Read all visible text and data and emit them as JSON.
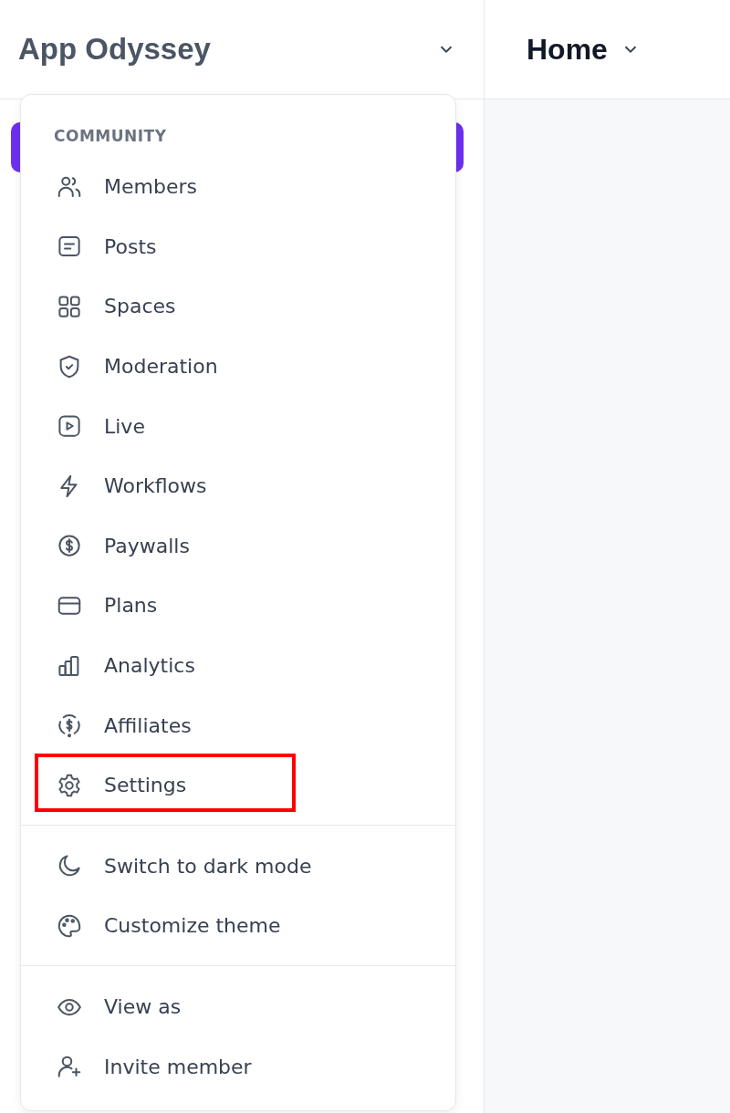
{
  "header": {
    "workspace": "App Odyssey",
    "page": "Home"
  },
  "menu": {
    "sections": [
      {
        "label": "COMMUNITY",
        "items": [
          {
            "label": "Members",
            "highlighted": false
          },
          {
            "label": "Posts",
            "highlighted": false
          },
          {
            "label": "Spaces",
            "highlighted": false
          },
          {
            "label": "Moderation",
            "highlighted": false
          },
          {
            "label": "Live",
            "highlighted": false
          },
          {
            "label": "Workflows",
            "highlighted": false
          },
          {
            "label": "Paywalls",
            "highlighted": false
          },
          {
            "label": "Plans",
            "highlighted": false
          },
          {
            "label": "Analytics",
            "highlighted": false
          },
          {
            "label": "Affiliates",
            "highlighted": false
          },
          {
            "label": "Settings",
            "highlighted": true
          }
        ]
      },
      {
        "items": [
          {
            "label": "Switch to dark mode",
            "highlighted": false
          },
          {
            "label": "Customize theme",
            "highlighted": false
          }
        ]
      },
      {
        "items": [
          {
            "label": "View as",
            "highlighted": false
          },
          {
            "label": "Invite member",
            "highlighted": false
          }
        ]
      }
    ]
  }
}
